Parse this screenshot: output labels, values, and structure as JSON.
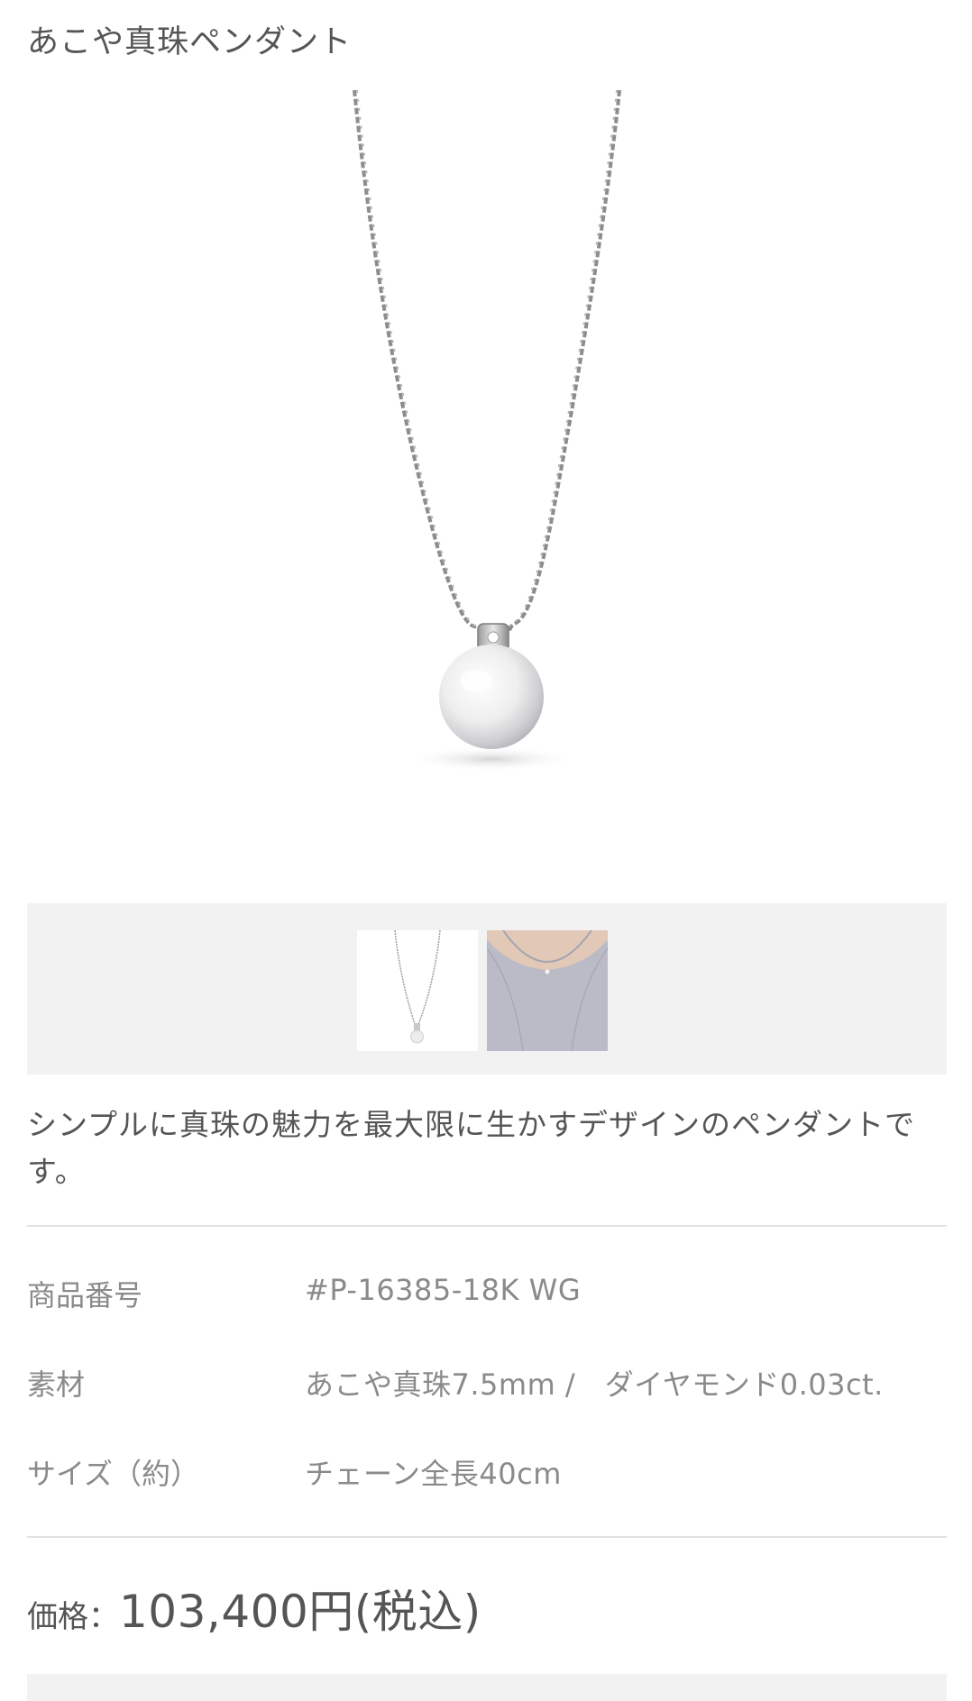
{
  "product": {
    "title": "あこや真珠ペンダント",
    "main_image_alt": "pearl-pendant-necklace",
    "thumbnails": [
      {
        "name": "thumbnail-pendant"
      },
      {
        "name": "thumbnail-model-wearing"
      }
    ],
    "description": "シンプルに真珠の魅力を最大限に生かすデザインのペンダントです。"
  },
  "specs": [
    {
      "label": "商品番号",
      "value": "#P-16385-18K WG"
    },
    {
      "label": "素材",
      "value": "あこや真珠7.5mm /　ダイヤモンド0.03ct."
    },
    {
      "label": "サイズ（約）",
      "value": "チェーン全長40cm"
    }
  ],
  "price": {
    "label": "価格：",
    "value": "103,400円(税込)"
  },
  "colors": {
    "text": "#555555",
    "muted": "#8a8a8a",
    "strip_bg": "#f2f2f2",
    "divider": "#e3e3e3"
  }
}
